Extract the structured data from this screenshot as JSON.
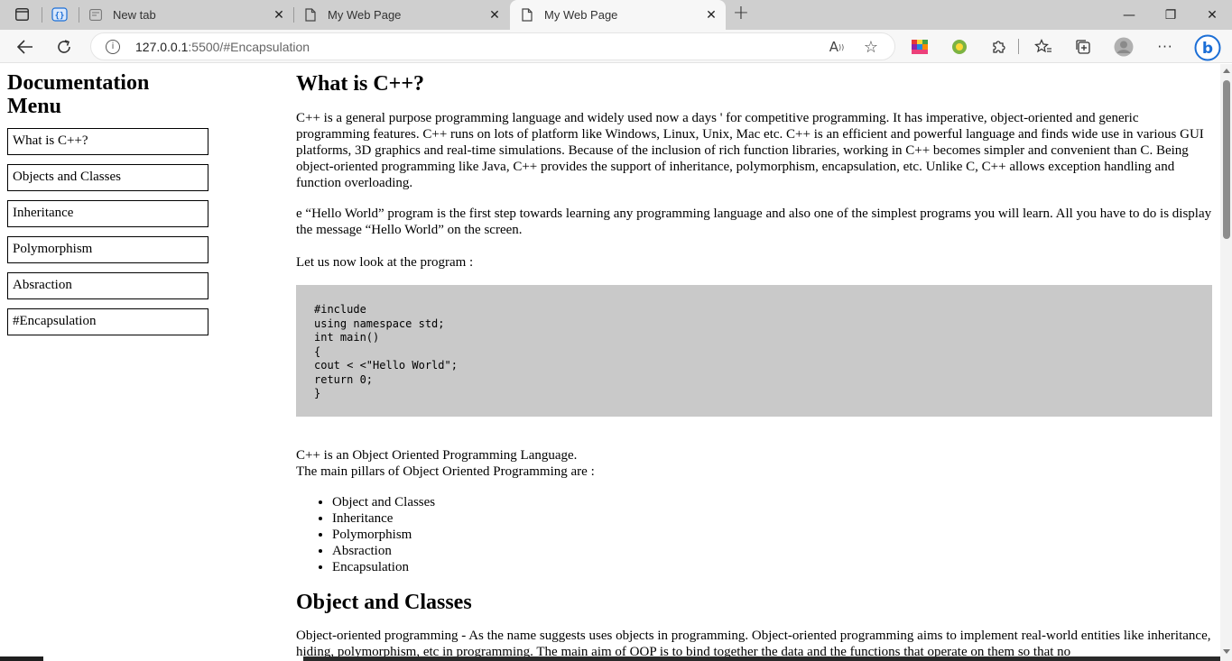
{
  "browser": {
    "tabs": [
      {
        "title": "New tab",
        "active": false
      },
      {
        "title": "My Web Page",
        "active": false
      },
      {
        "title": "My Web Page",
        "active": true
      }
    ],
    "new_tab_glyph": "+",
    "address": {
      "host": "127.0.0.1",
      "path": ":5500/#Encapsulation"
    },
    "window_controls": {
      "minimize": "—",
      "restore": "❐",
      "close": "✕"
    }
  },
  "nav": {
    "title": "Documentation Menu",
    "links": [
      {
        "label": "What is C++?"
      },
      {
        "label": "Objects and Classes"
      },
      {
        "label": "Inheritance"
      },
      {
        "label": "Polymorphism"
      },
      {
        "label": "Absraction"
      },
      {
        "label": "#Encapsulation"
      }
    ]
  },
  "main": {
    "section1": {
      "title": "What is C++?",
      "para1": "C++ is a general purpose programming language and widely used now a days ' for competitive programming. It has imperative, object-oriented and generic programming features. C++ runs on lots of platform like Windows, Linux, Unix, Mac etc. C++ is an efficient and powerful language and finds wide use in various GUI platforms, 3D graphics and real-time simulations. Because of the inclusion of rich function libraries, working in C++ becomes simpler and convenient than C. Being object-oriented programming like Java, C++ provides the support of inheritance, polymorphism, encapsulation, etc. Unlike C, C++ allows exception handling and function overloading.",
      "para2": "e “Hello World” program is the first step towards learning any programming language and also one of the simplest programs you will learn. All you have to do is display the message “Hello World” on the screen.",
      "para3": "Let us now look at the program :",
      "code": "#include\nusing namespace std;\nint main()\n{\ncout < <\"Hello World\";\nreturn 0;\n}",
      "oop_line1": "C++ is an Object Oriented Programming Language.",
      "oop_line2": "The main pillars of Object Oriented Programming are :",
      "pillars": [
        "Object and Classes",
        "Inheritance",
        "Polymorphism",
        "Absraction",
        "Encapsulation"
      ]
    },
    "section2": {
      "title": "Object and Classes",
      "para1": "Object-oriented programming - As the name suggests uses objects in programming. Object-oriented programming aims to implement real-world entities like inheritance, hiding, polymorphism, etc in programming. The main aim of OOP is to bind together the data and the functions that operate on them so that no"
    }
  },
  "colors": {
    "tabbar_bg": "#cfcfcf",
    "toolbar_bg": "#f7f7f7",
    "code_bg": "#c9c9c9",
    "bing_blue": "#1b6ed6"
  }
}
